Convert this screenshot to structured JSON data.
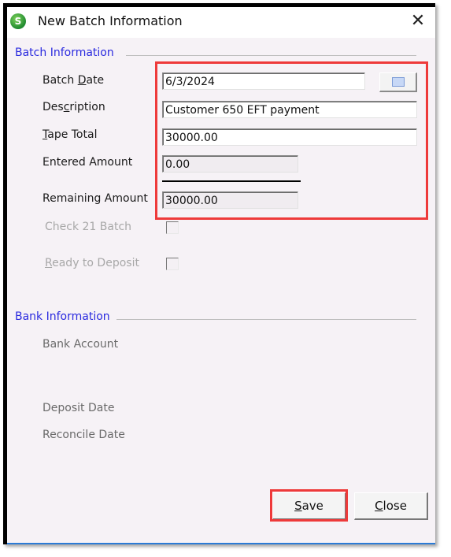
{
  "window": {
    "title": "New Batch Information",
    "app_icon_letter": "S",
    "close_glyph": "✕"
  },
  "batch_info": {
    "section_title": "Batch Information",
    "batch_date": {
      "label_pre": "Batch ",
      "label_key": "D",
      "label_post": "ate",
      "value": "6/3/2024"
    },
    "description": {
      "label_pre": "Des",
      "label_key": "c",
      "label_post": "ription",
      "value": "Customer 650 EFT payment"
    },
    "tape_total": {
      "label_pre": "",
      "label_key": "T",
      "label_post": "ape Total",
      "value": "30000.00"
    },
    "entered_amount": {
      "label": "Entered Amount",
      "value": "0.00"
    },
    "remaining_amount": {
      "label": "Remaining Amount",
      "value": "30000.00"
    },
    "check21": {
      "label": "Check 21 Batch",
      "checked": false
    },
    "ready_to_deposit": {
      "label_pre": "",
      "label_key": "R",
      "label_post": "eady to Deposit",
      "checked": false
    }
  },
  "bank_info": {
    "section_title": "Bank Information",
    "bank_account_label": "Bank Account",
    "deposit_date_label": "Deposit Date",
    "reconcile_date_label": "Reconcile Date"
  },
  "buttons": {
    "save": {
      "key": "S",
      "rest": "ave"
    },
    "close": {
      "key": "C",
      "rest": "lose"
    }
  },
  "colors": {
    "highlight": "#ee3a3a",
    "section": "#2a2adf"
  }
}
